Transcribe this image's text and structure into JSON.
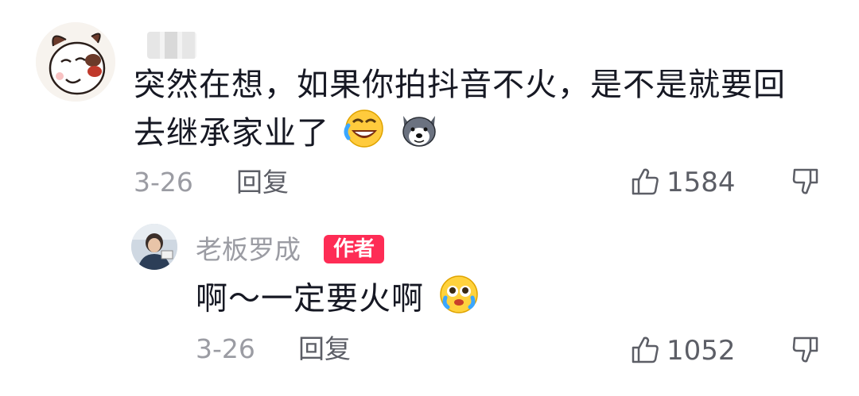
{
  "comment": {
    "text": "突然在想，如果你拍抖音不火，是不是就要回去继承家业了",
    "date": "3-26",
    "reply_label": "回复",
    "like_count": "1584",
    "emojis": [
      "laugh-cry-emoji",
      "husky-dog-emoji"
    ]
  },
  "reply": {
    "username": "老板罗成",
    "badge": "作者",
    "text": "啊～一定要火啊",
    "date": "3-26",
    "reply_label": "回复",
    "like_count": "1052",
    "emojis": [
      "pleading-cry-emoji"
    ]
  },
  "colors": {
    "text_primary": "#161823",
    "text_secondary": "#9b9ca3",
    "badge_bg": "#fe2c55"
  }
}
